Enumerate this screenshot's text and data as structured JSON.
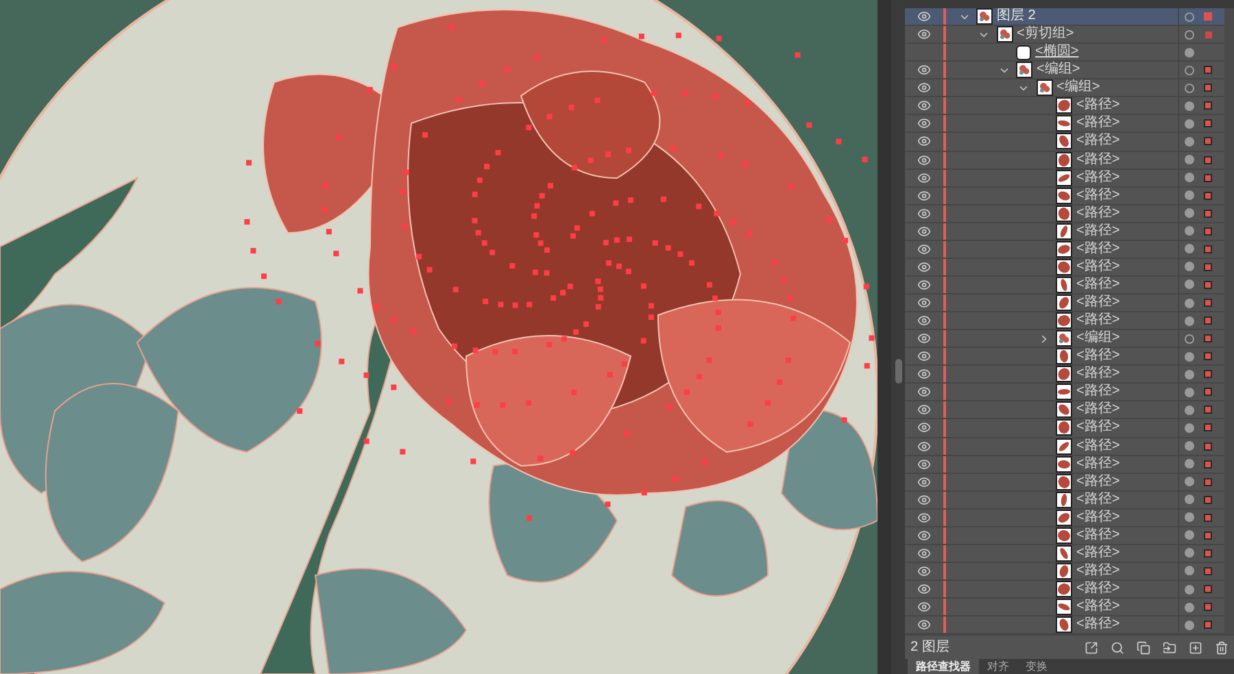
{
  "layers_panel": {
    "items": [
      {
        "kind": "layer",
        "label": "图层 2",
        "visible": true,
        "selected": true,
        "expanded": true,
        "children": [
          {
            "kind": "clip-group",
            "label": "<剪切组>",
            "visible": true,
            "selected": false,
            "expanded": true,
            "children": [
              {
                "kind": "clip-path",
                "label": "<椭圆>",
                "visible": false,
                "selected": false
              },
              {
                "kind": "group",
                "label": "<编组>",
                "visible": true,
                "selected": false,
                "expanded": true,
                "children": [
                  {
                    "kind": "group",
                    "label": "<编组>",
                    "visible": true,
                    "selected": false,
                    "expanded": true,
                    "children": [
                      {
                        "kind": "path",
                        "label": "<路径>",
                        "visible": true,
                        "selected": false
                      },
                      {
                        "kind": "path",
                        "label": "<路径>",
                        "visible": true,
                        "selected": false
                      },
                      {
                        "kind": "path",
                        "label": "<路径>",
                        "visible": true,
                        "selected": false
                      },
                      {
                        "kind": "path",
                        "label": "<路径>",
                        "visible": true,
                        "selected": false
                      },
                      {
                        "kind": "path",
                        "label": "<路径>",
                        "visible": true,
                        "selected": false
                      },
                      {
                        "kind": "path",
                        "label": "<路径>",
                        "visible": true,
                        "selected": false
                      },
                      {
                        "kind": "path",
                        "label": "<路径>",
                        "visible": true,
                        "selected": false
                      },
                      {
                        "kind": "path",
                        "label": "<路径>",
                        "visible": true,
                        "selected": false
                      },
                      {
                        "kind": "path",
                        "label": "<路径>",
                        "visible": true,
                        "selected": false
                      },
                      {
                        "kind": "path",
                        "label": "<路径>",
                        "visible": true,
                        "selected": false
                      },
                      {
                        "kind": "path",
                        "label": "<路径>",
                        "visible": true,
                        "selected": false
                      },
                      {
                        "kind": "path",
                        "label": "<路径>",
                        "visible": true,
                        "selected": false
                      },
                      {
                        "kind": "path",
                        "label": "<路径>",
                        "visible": true,
                        "selected": false
                      },
                      {
                        "kind": "group",
                        "label": "<编组>",
                        "visible": true,
                        "selected": false,
                        "expanded": false
                      },
                      {
                        "kind": "path",
                        "label": "<路径>",
                        "visible": true,
                        "selected": false
                      },
                      {
                        "kind": "path",
                        "label": "<路径>",
                        "visible": true,
                        "selected": false
                      },
                      {
                        "kind": "path",
                        "label": "<路径>",
                        "visible": true,
                        "selected": false
                      },
                      {
                        "kind": "path",
                        "label": "<路径>",
                        "visible": true,
                        "selected": false
                      },
                      {
                        "kind": "path",
                        "label": "<路径>",
                        "visible": true,
                        "selected": false
                      },
                      {
                        "kind": "path",
                        "label": "<路径>",
                        "visible": true,
                        "selected": false
                      },
                      {
                        "kind": "path",
                        "label": "<路径>",
                        "visible": true,
                        "selected": false
                      },
                      {
                        "kind": "path",
                        "label": "<路径>",
                        "visible": true,
                        "selected": false
                      },
                      {
                        "kind": "path",
                        "label": "<路径>",
                        "visible": true,
                        "selected": false
                      },
                      {
                        "kind": "path",
                        "label": "<路径>",
                        "visible": true,
                        "selected": false
                      },
                      {
                        "kind": "path",
                        "label": "<路径>",
                        "visible": true,
                        "selected": false
                      },
                      {
                        "kind": "path",
                        "label": "<路径>",
                        "visible": true,
                        "selected": false
                      },
                      {
                        "kind": "path",
                        "label": "<路径>",
                        "visible": true,
                        "selected": false
                      },
                      {
                        "kind": "path",
                        "label": "<路径>",
                        "visible": true,
                        "selected": false
                      },
                      {
                        "kind": "path",
                        "label": "<路径>",
                        "visible": true,
                        "selected": false
                      },
                      {
                        "kind": "path",
                        "label": "<路径>",
                        "visible": true,
                        "selected": false
                      }
                    ]
                  }
                ]
              }
            ]
          }
        ]
      }
    ]
  },
  "footer": {
    "count": "2 图层"
  },
  "tabs": [
    {
      "label": "路径查找器",
      "selected": true
    },
    {
      "label": "对齐",
      "selected": false
    },
    {
      "label": "变换",
      "selected": false
    }
  ]
}
